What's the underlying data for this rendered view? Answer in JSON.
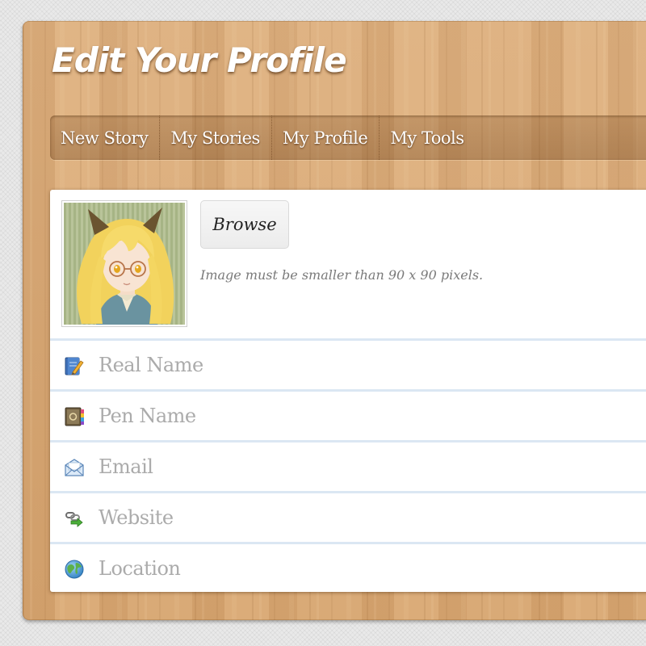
{
  "page": {
    "title": "Edit Your Profile"
  },
  "nav": {
    "items": [
      {
        "label": "New Story"
      },
      {
        "label": "My Stories"
      },
      {
        "label": "My Profile"
      },
      {
        "label": "My Tools"
      }
    ]
  },
  "avatar": {
    "browse_label": "Browse",
    "hint": "Image must be smaller than 90 x 90 pixels."
  },
  "fields": [
    {
      "placeholder": "Real Name",
      "value": "",
      "icon": "notebook-pencil-icon"
    },
    {
      "placeholder": "Pen Name",
      "value": "",
      "icon": "address-book-icon"
    },
    {
      "placeholder": "Email",
      "value": "",
      "icon": "envelope-icon"
    },
    {
      "placeholder": "Website",
      "value": "",
      "icon": "link-arrow-icon"
    },
    {
      "placeholder": "Location",
      "value": "",
      "icon": "globe-icon"
    }
  ],
  "colors": {
    "wood": "#d9a974",
    "field_divider": "#dbe7f3",
    "placeholder": "#ababab"
  }
}
